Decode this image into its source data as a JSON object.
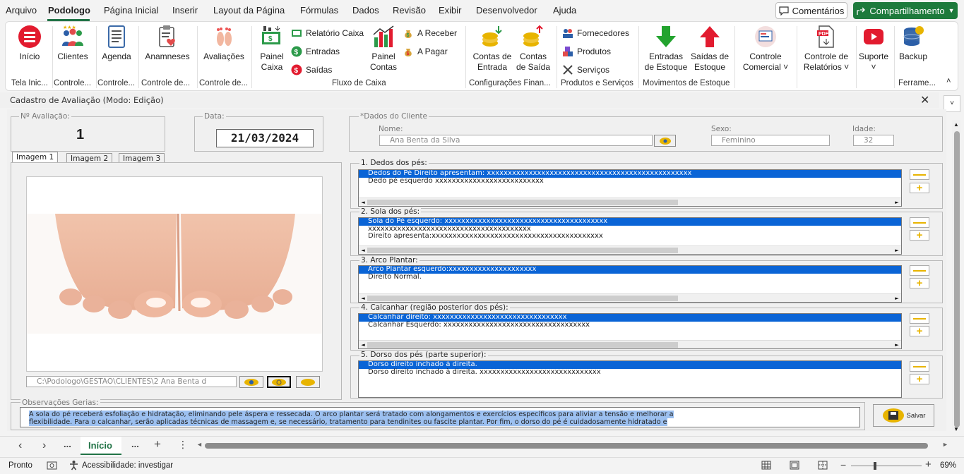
{
  "menu": {
    "items": [
      "Arquivo",
      "Podologo",
      "Página Inicial",
      "Inserir",
      "Layout da Página",
      "Fórmulas",
      "Dados",
      "Revisão",
      "Exibir",
      "Desenvolvedor",
      "Ajuda"
    ],
    "comments_label": "Comentários",
    "share_label": "Compartilhamento"
  },
  "ribbon": {
    "buttons": {
      "inicio": "Início",
      "clientes": "Clientes",
      "agenda": "Agenda",
      "anamneses": "Anamneses",
      "avaliacoes": "Avaliações",
      "painel_caixa_1": "Painel",
      "painel_caixa_2": "Caixa",
      "relatorio_caixa": "Relatório Caixa",
      "entradas": "Entradas",
      "saidas": "Saídas",
      "painel_contas_1": "Painel",
      "painel_contas_2": "Contas",
      "a_receber": "A Receber",
      "a_pagar": "A Pagar",
      "contas_entrada_1": "Contas de",
      "contas_entrada_2": "Entrada",
      "contas_saida_1": "Contas",
      "contas_saida_2": "de Saída",
      "fornecedores": "Fornecedores",
      "produtos": "Produtos",
      "servicos": "Serviços",
      "entradas_estoque_1": "Entradas",
      "entradas_estoque_2": "de Estoque",
      "saidas_estoque_1": "Saídas de",
      "saidas_estoque_2": "Estoque",
      "controle_comercial_1": "Controle",
      "controle_comercial_2": "Comercial ˅",
      "controle_relatorios_1": "Controle de",
      "controle_relatorios_2": "Relatórios ˅",
      "suporte": "Suporte",
      "suporte_chevron": "˅",
      "backup": "Backup"
    },
    "groups": {
      "g1": "Tela Inic...",
      "g2": "Controle...",
      "g3": "Controle...",
      "g4": "Controle de...",
      "g5": "Controle de...",
      "g6": "Fluxo de Caixa",
      "g7": "Configurações Finan...",
      "g8": "Produtos e Serviços",
      "g9": "Movimentos de Estoque",
      "g10": "Ferrame..."
    }
  },
  "form": {
    "title": "Cadastro de Avaliação (Modo: Edição)",
    "n_avaliacao_label": "Nº Avaliação:",
    "n_avaliacao_value": "1",
    "data_label": "Data:",
    "data_value": "21/03/2024",
    "client_frame_label": "*Dados do Cliente",
    "nome_label": "Nome:",
    "nome_value": "Ana Benta da Silva",
    "sexo_label": "Sexo:",
    "sexo_value": "Feminino",
    "idade_label": "Idade:",
    "idade_value": "32",
    "image_tabs": [
      "Imagem 1",
      "Imagem 2",
      "Imagem 3"
    ],
    "image_path": "C:\\Podologo\\GESTAO\\CLIENTES\\2 Ana Benta d",
    "sections": [
      {
        "label": "1. Dedos dos pés:",
        "lines": [
          "Dedos do Pé Direito apresentam: xxxxxxxxxxxxxxxxxxxxxxxxxxxxxxxxxxxxxxxxxxxxxxxxx",
          "Dedo pé esquerdo xxxxxxxxxxxxxxxxxxxxxxxxxx"
        ]
      },
      {
        "label": "2. Sola dos pés:",
        "lines": [
          "Sola do Pé esquerdo: xxxxxxxxxxxxxxxxxxxxxxxxxxxxxxxxxxxxxxx",
          "xxxxxxxxxxxxxxxxxxxxxxxxxxxxxxxxxxxxxxx",
          "Direito apresenta:xxxxxxxxxxxxxxxxxxxxxxxxxxxxxxxxxxxxxxxxx"
        ]
      },
      {
        "label": "3. Arco Plantar:",
        "lines": [
          "Arco Plantar esquerdo:xxxxxxxxxxxxxxxxxxxxx",
          "Direito Normal."
        ]
      },
      {
        "label": "4. Calcanhar (região posterior dos pés):",
        "lines": [
          "Calcanhar direito: xxxxxxxxxxxxxxxxxxxxxxxxxxxxxxxx",
          "Calcanhar Esquerdo: xxxxxxxxxxxxxxxxxxxxxxxxxxxxxxxxxxx"
        ]
      },
      {
        "label": "5. Dorso dos pés (parte superior):",
        "lines": [
          "Dorso direito inchado à direita.",
          "Dorso direito inchado à direita.  xxxxxxxxxxxxxxxxxxxxxxxxxxxxx"
        ]
      }
    ],
    "obs_label": "Observações Gerias:",
    "obs_line1": "A sola do pé receberá esfoliação e hidratação, eliminando pele áspera e ressecada. O arco plantar será tratado com alongamentos e exercícios específicos para aliviar a tensão e melhorar a",
    "obs_line2": "flexibilidade. Para o calcanhar, serão aplicadas técnicas de massagem e, se necessário, tratamento para tendinites ou fascite plantar. Por fim, o dorso do pé é cuidadosamente hidratado e",
    "salvar_label": "Salvar"
  },
  "sheetbar": {
    "active_tab": "Início",
    "more": "...",
    "add": "+",
    "menu": "⋮"
  },
  "status": {
    "ready": "Pronto",
    "accessibility": "Acessibilidade: investigar",
    "zoom": "69%"
  },
  "colors": {
    "accent_green": "#217346",
    "share_green": "#1d7a3c",
    "selection_blue": "#0a64d6",
    "yellow_button": "#e8b400"
  }
}
